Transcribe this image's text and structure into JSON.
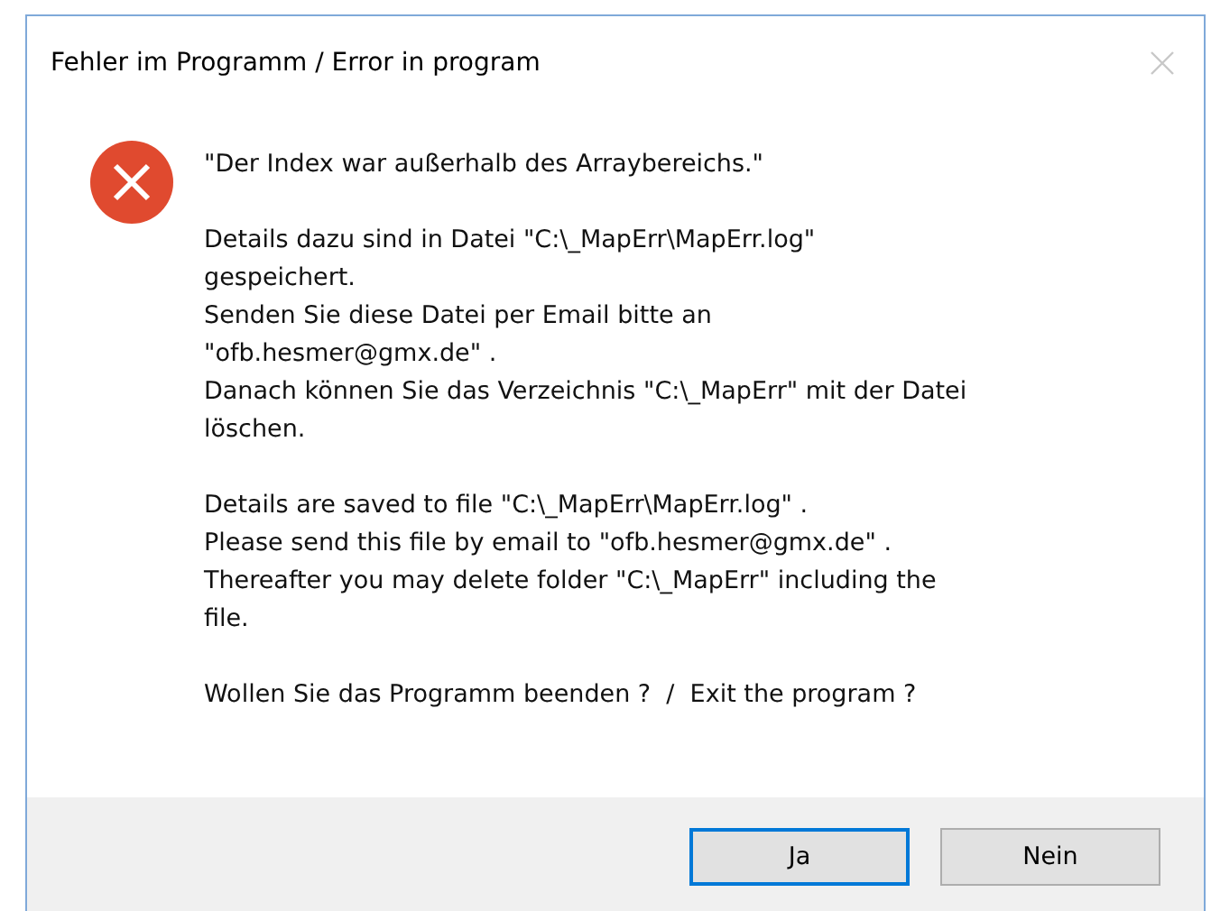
{
  "window": {
    "title": "Fehler im Programm / Error in program"
  },
  "message": {
    "paragraphs": [
      [
        "\"Der Index war außerhalb des Arraybereichs.\""
      ],
      [
        "Details dazu sind in Datei \"C:\\_MapErr\\MapErr.log\"",
        "gespeichert.",
        "Senden Sie diese Datei per Email bitte an",
        "\"ofb.hesmer@gmx.de\" .",
        "Danach können Sie das Verzeichnis \"C:\\_MapErr\" mit der Datei",
        "löschen."
      ],
      [
        "Details are saved to file \"C:\\_MapErr\\MapErr.log\" .",
        "Please send this file by email to \"ofb.hesmer@gmx.de\" .",
        "Thereafter you may delete folder \"C:\\_MapErr\" including the",
        "file."
      ],
      [
        "Wollen Sie das Programm beenden ?  /  Exit the program ?"
      ]
    ]
  },
  "buttons": [
    {
      "label": "Ja",
      "default": true
    },
    {
      "label": "Nein",
      "default": false
    }
  ]
}
